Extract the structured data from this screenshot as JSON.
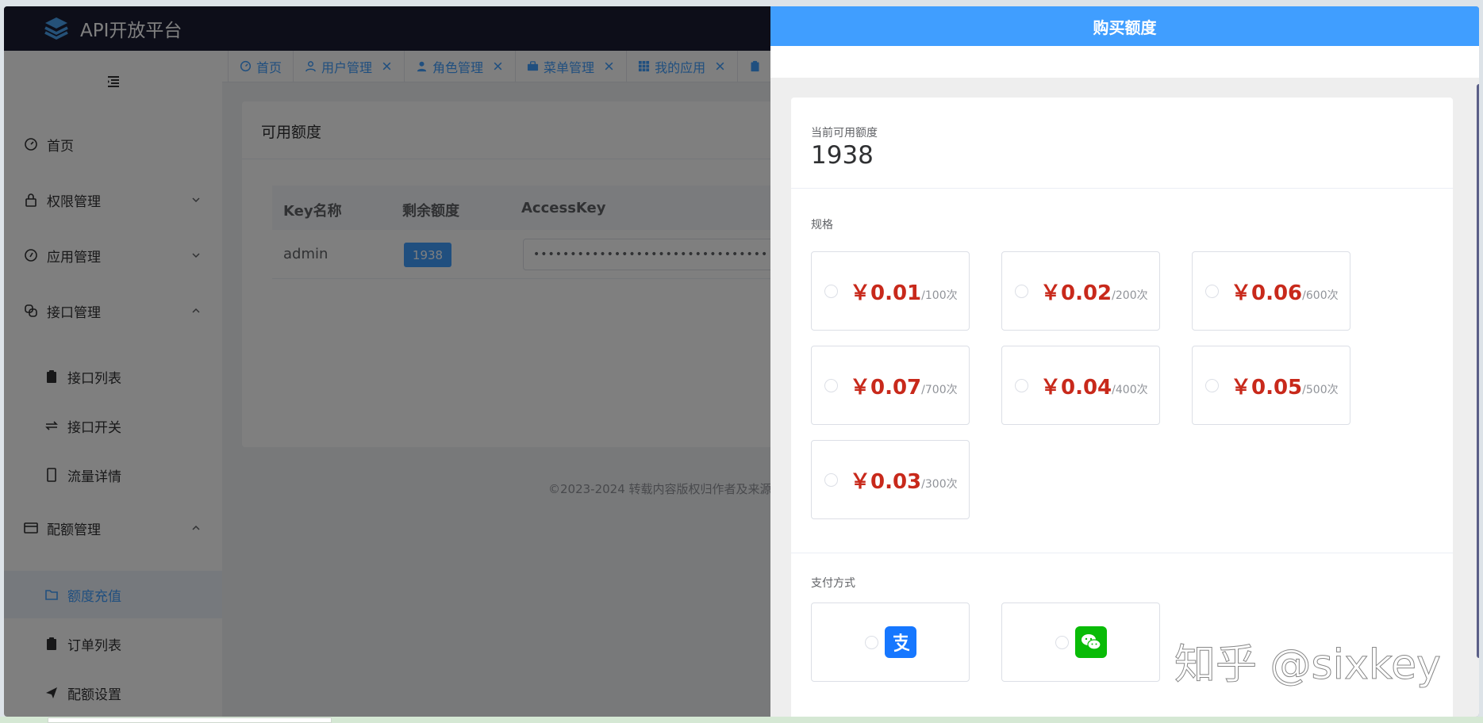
{
  "app": {
    "title": "API开放平台"
  },
  "sidebar": {
    "items": [
      {
        "label": "首页",
        "icon": "dashboard-icon",
        "chevron": ""
      },
      {
        "label": "权限管理",
        "icon": "lock-icon",
        "chevron": "down"
      },
      {
        "label": "应用管理",
        "icon": "compass-icon",
        "chevron": "down"
      },
      {
        "label": "接口管理",
        "icon": "link-icon",
        "chevron": "up"
      }
    ],
    "api_sub": [
      {
        "label": "接口列表",
        "icon": "clipboard-icon"
      },
      {
        "label": "接口开关",
        "icon": "switch-arrows-icon"
      },
      {
        "label": "流量详情",
        "icon": "phone-icon"
      }
    ],
    "quota": {
      "label": "配额管理",
      "icon": "card-icon",
      "chevron": "up"
    },
    "quota_sub": [
      {
        "label": "额度充值",
        "icon": "folder-icon",
        "active": true
      },
      {
        "label": "订单列表",
        "icon": "clipboard-icon"
      },
      {
        "label": "配额设置",
        "icon": "send-icon"
      }
    ]
  },
  "tabs": [
    {
      "label": "首页",
      "icon": "dashboard-icon",
      "closable": false
    },
    {
      "label": "用户管理",
      "icon": "user-icon",
      "closable": true
    },
    {
      "label": "角色管理",
      "icon": "user-filled-icon",
      "closable": true
    },
    {
      "label": "菜单管理",
      "icon": "briefcase-icon",
      "closable": true
    },
    {
      "label": "我的应用",
      "icon": "grid-icon",
      "closable": true
    }
  ],
  "main": {
    "card_title": "可用额度",
    "columns": [
      "Key名称",
      "剩余额度",
      "AccessKey"
    ],
    "row": {
      "name": "admin",
      "quota": "1938",
      "access_key": "••••••••••••••••••••••••••••••••"
    },
    "footer": "©2023-2024 转载内容版权归作者及来源"
  },
  "drawer": {
    "title": "购买额度",
    "current_label": "当前可用额度",
    "current_value": "1938",
    "spec_label": "规格",
    "specs": [
      {
        "price": "￥0.01",
        "per": "/100次"
      },
      {
        "price": "￥0.02",
        "per": "/200次"
      },
      {
        "price": "￥0.06",
        "per": "/600次"
      },
      {
        "price": "￥0.07",
        "per": "/700次"
      },
      {
        "price": "￥0.04",
        "per": "/400次"
      },
      {
        "price": "￥0.05",
        "per": "/500次"
      },
      {
        "price": "￥0.03",
        "per": "/300次"
      }
    ],
    "pay_label": "支付方式",
    "pay_methods": [
      {
        "icon": "alipay-icon",
        "color": "#1677ff"
      },
      {
        "icon": "wechat-pay-icon",
        "color": "#09bb07"
      }
    ]
  },
  "watermark": "知乎 @sixkey",
  "colors": {
    "primary": "#409eff",
    "header_bg": "#1a1d33",
    "price": "#c8291b"
  }
}
